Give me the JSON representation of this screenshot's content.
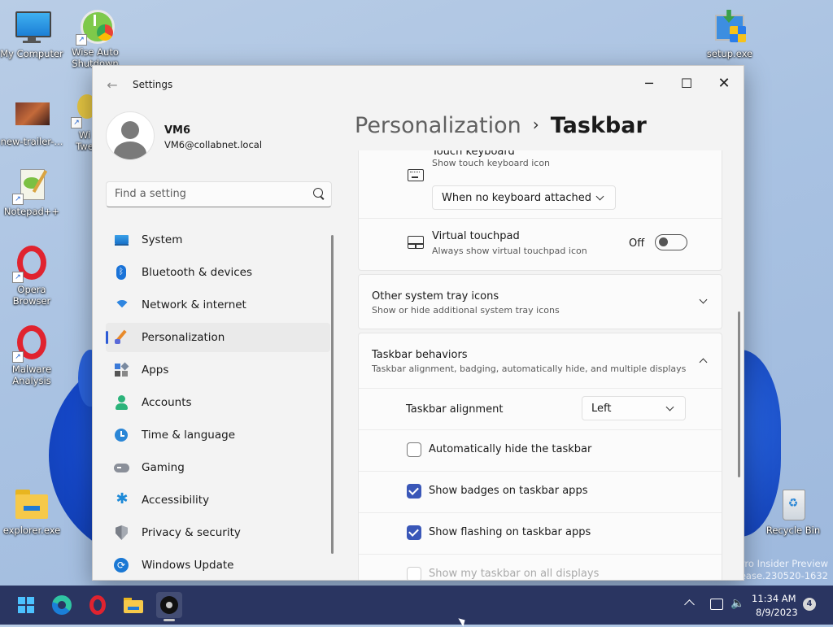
{
  "desktop": {
    "icons": [
      {
        "label": "My Computer"
      },
      {
        "label": "Wise Auto Shutdown"
      },
      {
        "label": "new-trailer-..."
      },
      {
        "label": "Wi Twe"
      },
      {
        "label": "Notepad++"
      },
      {
        "label": "Opera Browser"
      },
      {
        "label": "Malware Analysis"
      },
      {
        "label": "explorer.exe"
      },
      {
        "label": "setup.exe"
      },
      {
        "label": "Recycle Bin"
      }
    ],
    "watermark": [
      "Pro Insider Preview",
      "release.230520-1632"
    ]
  },
  "window": {
    "title": "Settings",
    "controls": {
      "minimize": "─",
      "maximize": "☐",
      "close": "✕"
    }
  },
  "user": {
    "name": "VM6",
    "email": "VM6@collabnet.local"
  },
  "search": {
    "placeholder": "Find a setting"
  },
  "nav": {
    "items": [
      {
        "label": "System",
        "icon": "system-icon"
      },
      {
        "label": "Bluetooth & devices",
        "icon": "bluetooth-icon"
      },
      {
        "label": "Network & internet",
        "icon": "wifi-icon"
      },
      {
        "label": "Personalization",
        "icon": "brush-icon",
        "active": true
      },
      {
        "label": "Apps",
        "icon": "apps-icon"
      },
      {
        "label": "Accounts",
        "icon": "accounts-icon"
      },
      {
        "label": "Time & language",
        "icon": "clock-icon"
      },
      {
        "label": "Gaming",
        "icon": "gamepad-icon"
      },
      {
        "label": "Accessibility",
        "icon": "accessibility-icon"
      },
      {
        "label": "Privacy & security",
        "icon": "shield-icon"
      },
      {
        "label": "Windows Update",
        "icon": "update-icon"
      }
    ]
  },
  "breadcrumb": {
    "parent": "Personalization",
    "separator": "›",
    "current": "Taskbar"
  },
  "settings": {
    "touch_keyboard": {
      "title": "Touch keyboard",
      "subtitle": "Show touch keyboard icon",
      "dropdown_value": "When no keyboard attached"
    },
    "virtual_touchpad": {
      "title": "Virtual touchpad",
      "subtitle": "Always show virtual touchpad icon",
      "toggle_state": "Off"
    },
    "other_tray": {
      "title": "Other system tray icons",
      "subtitle": "Show or hide additional system tray icons"
    },
    "behaviors": {
      "title": "Taskbar behaviors",
      "subtitle": "Taskbar alignment, badging, automatically hide, and multiple displays",
      "alignment_label": "Taskbar alignment",
      "alignment_value": "Left",
      "options": [
        {
          "label": "Automatically hide the taskbar",
          "checked": false
        },
        {
          "label": "Show badges on taskbar apps",
          "checked": true
        },
        {
          "label": "Show flashing on taskbar apps",
          "checked": true
        },
        {
          "label": "Show my taskbar on all displays",
          "checked": false,
          "disabled": true
        }
      ]
    }
  },
  "taskbar": {
    "apps": [
      "start",
      "edge",
      "opera",
      "file-explorer",
      "settings"
    ],
    "time": "11:34 AM",
    "date": "8/9/2023",
    "notifications": "4"
  },
  "colors": {
    "accent": "#3a57b8",
    "taskbar": "#2a3561"
  }
}
